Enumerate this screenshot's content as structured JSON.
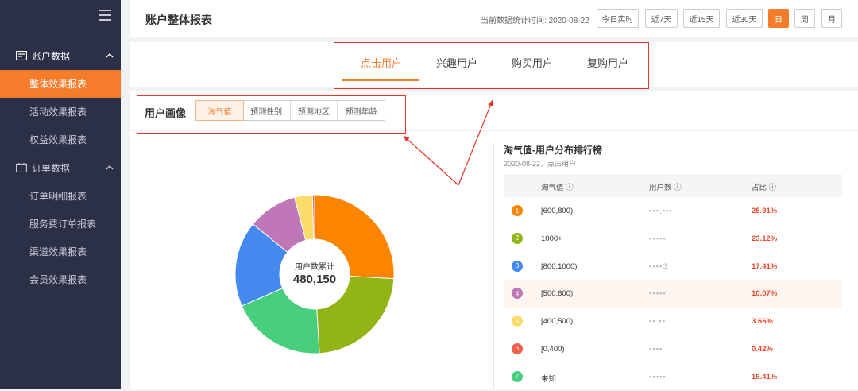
{
  "sidebar": {
    "groups": [
      {
        "label": "账户数据",
        "items": [
          "整体效果报表",
          "活动效果报表",
          "权益效果报表"
        ]
      },
      {
        "label": "订单数据",
        "items": [
          "订单明细报表",
          "服务费订单报表",
          "渠道效果报表",
          "会员效果报表"
        ]
      }
    ]
  },
  "header": {
    "title": "账户整体报表",
    "stat_time_label": "当前数据统计时间:",
    "stat_time_value": "2020-08-22",
    "ranges": [
      "今日实时",
      "近7天",
      "近15天",
      "近30天",
      "日",
      "周",
      "月"
    ],
    "active_range": "日"
  },
  "tabs": {
    "items": [
      "点击用户",
      "兴趣用户",
      "购买用户",
      "复购用户"
    ],
    "active": "点击用户"
  },
  "portrait": {
    "title": "用户画像",
    "segments": [
      "淘气值",
      "预测性别",
      "预测地区",
      "预测年龄"
    ],
    "active": "淘气值"
  },
  "donut": {
    "center_label": "用户数累计",
    "center_value": "480,150"
  },
  "ranking": {
    "title": "淘气值-用户分布排行榜",
    "subtitle": "2020-08-22，点击用户",
    "columns": [
      "淘气值 ⓘ",
      "用户数 ⓘ",
      "占比 ⓘ"
    ],
    "rows": [
      {
        "rank": "1",
        "range": "[600,800)",
        "users": "▪▪▪,▪▪▪",
        "pct": "25.91%"
      },
      {
        "rank": "2",
        "range": "1000+",
        "users": "▪▪▪▪▪",
        "pct": "23.12%"
      },
      {
        "rank": "3",
        "range": "[800,1000)",
        "users": "▪▪▪▪3",
        "pct": "17.41%"
      },
      {
        "rank": "4",
        "range": "[500,600)",
        "users": "▪▪▪▪▪",
        "pct": "10.07%"
      },
      {
        "rank": "5",
        "range": "[400,500)",
        "users": "▪▪,▪▪",
        "pct": "3.66%"
      },
      {
        "rank": "6",
        "range": "[0,400)",
        "users": "▪▪▪▪",
        "pct": "0.42%"
      },
      {
        "rank": "7",
        "range": "未知",
        "users": "▪▪▪▪▪",
        "pct": "19.41%"
      }
    ]
  },
  "chart_data": {
    "type": "pie",
    "categories": [
      "[600,800)",
      "1000+",
      "[800,1000)",
      "[500,600)",
      "[400,500)",
      "[0,400)",
      "未知"
    ],
    "values": [
      25.91,
      23.12,
      17.41,
      10.07,
      3.66,
      0.42,
      19.41
    ],
    "order_clockwise_from_top": [
      "[600,800)",
      "1000+",
      "未知",
      "[800,1000)",
      "[500,600)",
      "[400,500)",
      "[0,400)"
    ],
    "colors": {
      "[600,800)": "#fb8500",
      "1000+": "#92b414",
      "[800,1000)": "#4389ee",
      "[500,600)": "#bf77b7",
      "[400,500)": "#fddb6a",
      "[0,400)": "#f0604a",
      "未知": "#48cf7e"
    }
  }
}
